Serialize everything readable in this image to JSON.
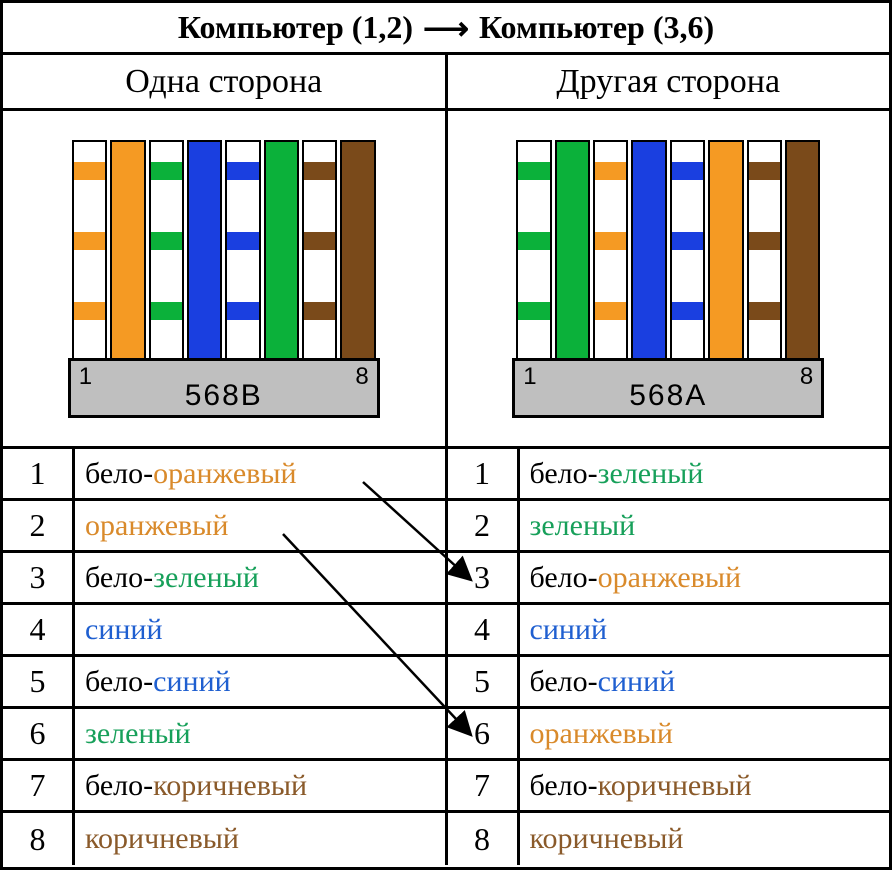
{
  "title": {
    "left": "Компьютер (1,2)",
    "arrow": "⟶",
    "right": "Компьютер (3,6)"
  },
  "subheader": {
    "left": "Одна сторона",
    "right": "Другая сторона"
  },
  "connectors": {
    "left": {
      "standard": "568B",
      "pin1": "1",
      "pin8": "8"
    },
    "right": {
      "standard": "568A",
      "pin1": "1",
      "pin8": "8"
    }
  },
  "colors": {
    "orange": "#f59a23",
    "green": "#0bb13a",
    "blue": "#1a3fe0",
    "brown": "#7a4a1a"
  },
  "wire_sequences": {
    "568B": [
      {
        "type": "striped",
        "color": "orange"
      },
      {
        "type": "solid",
        "color": "orange"
      },
      {
        "type": "striped",
        "color": "green"
      },
      {
        "type": "solid",
        "color": "blue"
      },
      {
        "type": "striped",
        "color": "blue"
      },
      {
        "type": "solid",
        "color": "green"
      },
      {
        "type": "striped",
        "color": "brown"
      },
      {
        "type": "solid",
        "color": "brown"
      }
    ],
    "568A": [
      {
        "type": "striped",
        "color": "green"
      },
      {
        "type": "solid",
        "color": "green"
      },
      {
        "type": "striped",
        "color": "orange"
      },
      {
        "type": "solid",
        "color": "blue"
      },
      {
        "type": "striped",
        "color": "blue"
      },
      {
        "type": "solid",
        "color": "orange"
      },
      {
        "type": "striped",
        "color": "brown"
      },
      {
        "type": "solid",
        "color": "brown"
      }
    ]
  },
  "rows": {
    "left": [
      {
        "n": "1",
        "parts": [
          {
            "text": "бело-",
            "cls": "c-black"
          },
          {
            "text": "оранжевый",
            "cls": "c-orange"
          }
        ]
      },
      {
        "n": "2",
        "parts": [
          {
            "text": "оранжевый",
            "cls": "c-orange"
          }
        ]
      },
      {
        "n": "3",
        "parts": [
          {
            "text": "бело-",
            "cls": "c-black"
          },
          {
            "text": "зеленый",
            "cls": "c-green"
          }
        ]
      },
      {
        "n": "4",
        "parts": [
          {
            "text": "синий",
            "cls": "c-blue"
          }
        ]
      },
      {
        "n": "5",
        "parts": [
          {
            "text": "бело-",
            "cls": "c-black"
          },
          {
            "text": "синий",
            "cls": "c-blue"
          }
        ]
      },
      {
        "n": "6",
        "parts": [
          {
            "text": "зеленый",
            "cls": "c-green"
          }
        ]
      },
      {
        "n": "7",
        "parts": [
          {
            "text": "бело-",
            "cls": "c-black"
          },
          {
            "text": "коричневый",
            "cls": "c-brown"
          }
        ]
      },
      {
        "n": "8",
        "parts": [
          {
            "text": "коричневый",
            "cls": "c-brown"
          }
        ]
      }
    ],
    "right": [
      {
        "n": "1",
        "parts": [
          {
            "text": "бело-",
            "cls": "c-black"
          },
          {
            "text": "зеленый",
            "cls": "c-green"
          }
        ]
      },
      {
        "n": "2",
        "parts": [
          {
            "text": "зеленый",
            "cls": "c-green"
          }
        ]
      },
      {
        "n": "3",
        "parts": [
          {
            "text": "бело-",
            "cls": "c-black"
          },
          {
            "text": "оранжевый",
            "cls": "c-orange"
          }
        ]
      },
      {
        "n": "4",
        "parts": [
          {
            "text": "синий",
            "cls": "c-blue"
          }
        ]
      },
      {
        "n": "5",
        "parts": [
          {
            "text": "бело-",
            "cls": "c-black"
          },
          {
            "text": "синий",
            "cls": "c-blue"
          }
        ]
      },
      {
        "n": "6",
        "parts": [
          {
            "text": "оранжевый",
            "cls": "c-orange"
          }
        ]
      },
      {
        "n": "7",
        "parts": [
          {
            "text": "бело-",
            "cls": "c-black"
          },
          {
            "text": "коричневый",
            "cls": "c-brown"
          }
        ]
      },
      {
        "n": "8",
        "parts": [
          {
            "text": "коричневый",
            "cls": "c-brown"
          }
        ]
      }
    ]
  },
  "crossover_map": [
    {
      "from": 1,
      "to": 3
    },
    {
      "from": 2,
      "to": 6
    }
  ]
}
